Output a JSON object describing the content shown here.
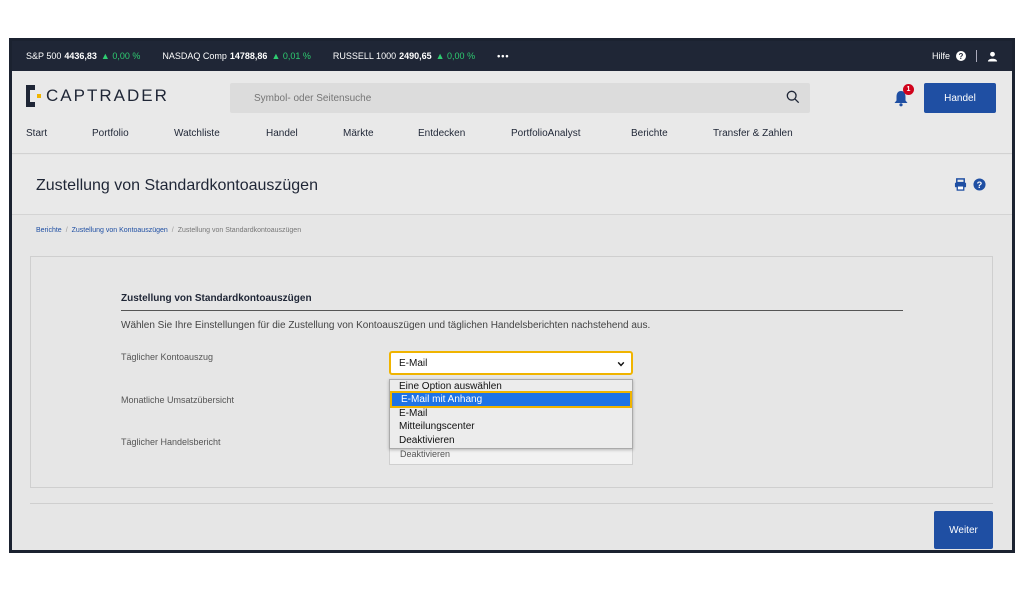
{
  "ticker": {
    "items": [
      {
        "name": "S&P 500",
        "value": "4436,83",
        "change": "▲ 0,00 %"
      },
      {
        "name": "NASDAQ Comp",
        "value": "14788,86",
        "change": "▲ 0,01 %"
      },
      {
        "name": "RUSSELL 1000",
        "value": "2490,65",
        "change": "▲ 0,00 %"
      }
    ],
    "more": "•••",
    "help_label": "Hilfe",
    "help_icon": "question-circle-icon",
    "user_icon": "user-icon"
  },
  "header": {
    "logo_text": "CAPTRADER",
    "search_placeholder": "Symbol- oder Seitensuche",
    "notification_count": "1",
    "trade_button": "Handel"
  },
  "nav": {
    "items": [
      "Start",
      "Portfolio",
      "Watchliste",
      "Handel",
      "Märkte",
      "Entdecken",
      "PortfolioAnalyst",
      "Berichte",
      "Transfer & Zahlen"
    ]
  },
  "page": {
    "title": "Zustellung von Standardkontoauszügen",
    "icons": [
      "print-icon",
      "help-circle-icon"
    ]
  },
  "breadcrumb": {
    "items": [
      "Berichte",
      "Zustellung von Kontoauszügen",
      "Zustellung von Standardkontoauszügen"
    ],
    "separator": "/"
  },
  "form": {
    "section_title": "Zustellung von Standardkontoauszügen",
    "description": "Wählen Sie Ihre Einstellungen für die Zustellung von Kontoauszügen und täglichen Handelsberichten nachstehend aus.",
    "rows": [
      {
        "label": "Täglicher Kontoauszug",
        "value": "E-Mail"
      },
      {
        "label": "Monatliche Umsatzübersicht",
        "value": ""
      },
      {
        "label": "Täglicher Handelsbericht",
        "value": "Deaktivieren"
      }
    ],
    "dropdown_options": [
      "Eine Option auswählen",
      "E-Mail mit Anhang",
      "E-Mail",
      "Mitteilungscenter",
      "Deaktivieren"
    ],
    "highlighted_option": "E-Mail mit Anhang"
  },
  "footer": {
    "next_button": "Weiter"
  },
  "colors": {
    "dark_navy": "#1f2636",
    "primary_blue": "#1f4fa3",
    "highlight_yellow": "#f0b400",
    "positive_green": "#2ecc71",
    "alert_red": "#d0021b",
    "selected_option": "#1e73e6"
  }
}
